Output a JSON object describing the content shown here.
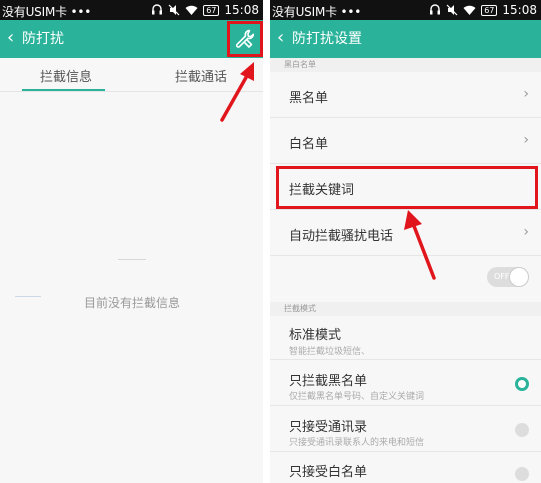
{
  "status_bar": {
    "carrier": "没有USIM卡 •••",
    "headset_icon": "headset-icon",
    "mute_icon": "mute-icon",
    "wifi_icon": "wifi-icon",
    "battery": "67",
    "time": "15:08"
  },
  "left_screen": {
    "title": "防打扰",
    "back_icon": "‹",
    "tabs": [
      {
        "label": "拦截信息",
        "active": true
      },
      {
        "label": "拦截通话",
        "active": false
      }
    ],
    "empty_message": "目前没有拦截信息"
  },
  "right_screen": {
    "title": "防打扰设置",
    "back_icon": "‹",
    "section_blackwhite": "黑白名单",
    "items": {
      "blacklist": "黑名单",
      "whitelist": "白名单",
      "keywords": "拦截关键词",
      "auto_block": "自动拦截骚扰电话"
    },
    "toggle_text": "OFF",
    "section_mode": "拦截模式",
    "modes": [
      {
        "label": "标准模式",
        "sub": "智能拦截垃圾短信、",
        "selected": false
      },
      {
        "label": "只拦截黑名单",
        "sub": "仅拦截黑名单号码、自定义关键词",
        "selected": true
      },
      {
        "label": "只接受通讯录",
        "sub": "只接受通讯录联系人的来电和短信",
        "selected": false
      },
      {
        "label": "只接受白名单",
        "sub": "",
        "selected": false
      }
    ],
    "chevron": "›"
  },
  "colors": {
    "accent": "#2ab39a",
    "highlight": "#e1161d",
    "status_bar": "#111111"
  }
}
